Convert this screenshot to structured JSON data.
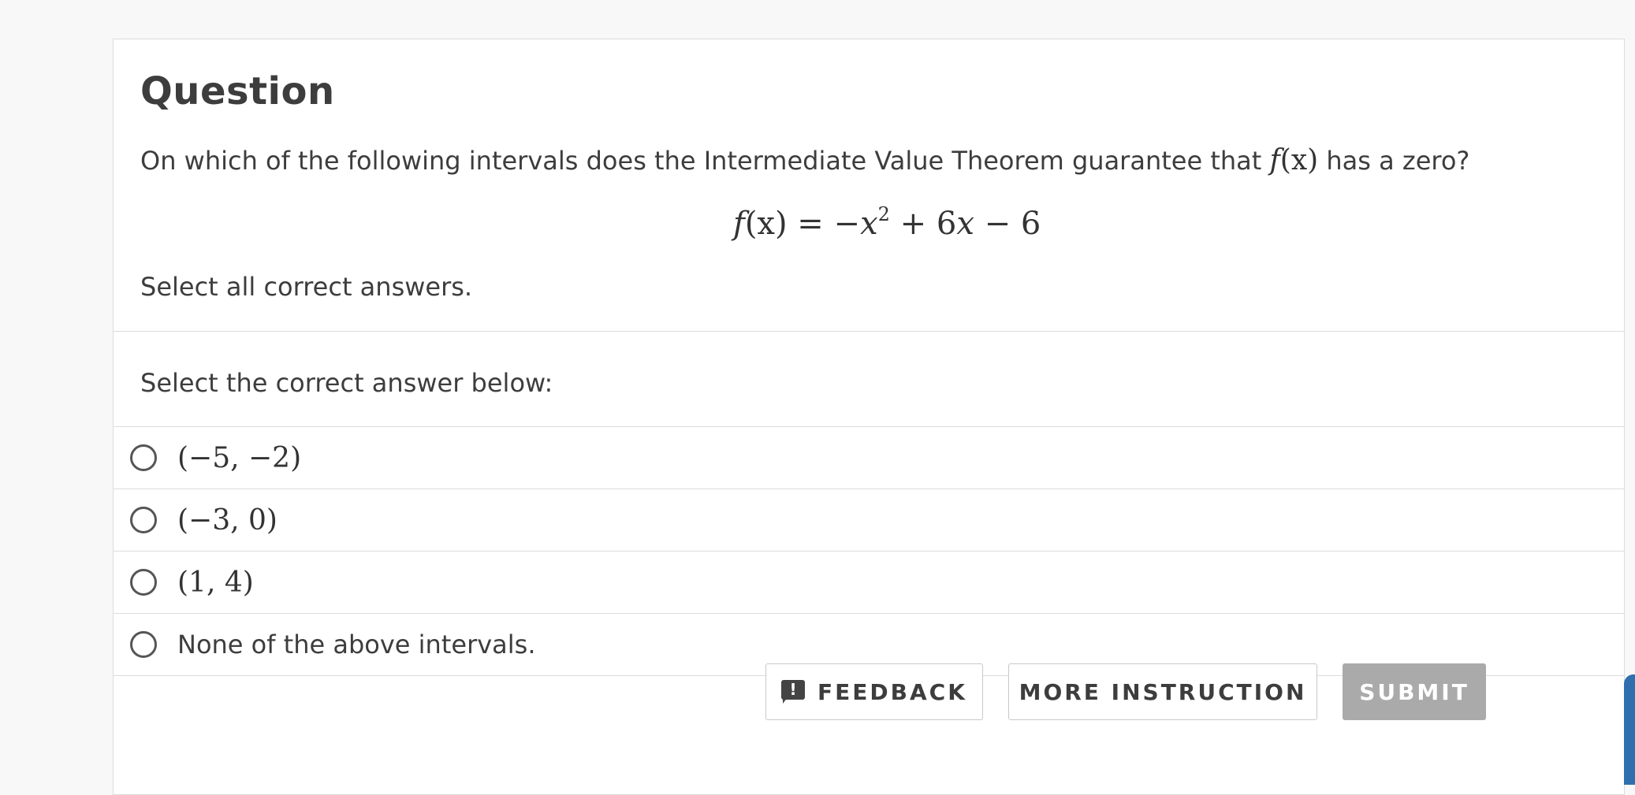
{
  "question": {
    "heading": "Question",
    "prompt_before": "On which of the following intervals does the Intermediate Value Theorem guarantee that",
    "prompt_math_f": "f",
    "prompt_math_x": "(x)",
    "prompt_after": "has a zero?",
    "equation": {
      "lhs": "f",
      "lhs_arg": "(x)",
      "eq": " = −",
      "var": "x",
      "exponent": "2",
      "rest_plus": " + 6",
      "rest_var": "x",
      "rest_end": " − 6"
    },
    "instruction": "Select all correct answers."
  },
  "answers": {
    "label": "Select the correct answer below:",
    "options": [
      {
        "label": "(−5, −2)",
        "selected": false
      },
      {
        "label": "(−3, 0)",
        "selected": false
      },
      {
        "label": "(1, 4)",
        "selected": false
      },
      {
        "label": "None of the above intervals.",
        "selected": false
      }
    ]
  },
  "buttons": {
    "feedback": "FEEDBACK",
    "more_instruction": "MORE INSTRUCTION",
    "submit": "SUBMIT"
  },
  "icons": {
    "feedback": "feedback-icon"
  },
  "colors": {
    "submit_disabled": "#aaaaaa",
    "side_tab": "#2f6fae"
  }
}
